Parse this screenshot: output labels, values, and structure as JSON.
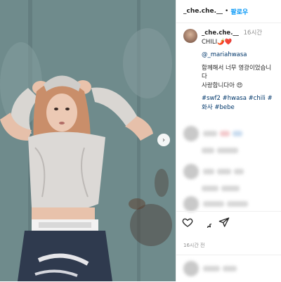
{
  "header": {
    "username": "_che.che.__",
    "separator": "•",
    "follow_label": "팔로우"
  },
  "caption": {
    "username": "_che.che.__",
    "time": "16시간",
    "line1": "CHILI🌶️❤️",
    "mention": "@_mariahwasa",
    "line2": "함께해서 너무 영광이었습니다",
    "line3": "사랑합니다아 😍",
    "tags": "#swf2 #hwasa #chili #화사 #bebe"
  },
  "footer": {
    "date": "16시간 전"
  },
  "photo": {
    "next_arrow": "›"
  }
}
